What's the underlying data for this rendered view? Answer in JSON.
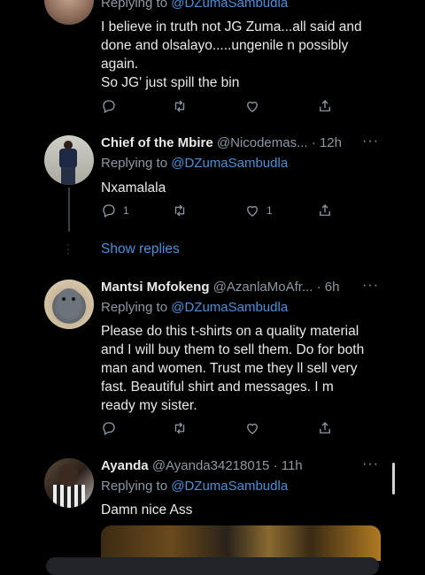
{
  "tweets": [
    {
      "reply_to_label": "Replying to ",
      "reply_to_handle": "@DZumaSambudla",
      "text_lines": [
        "I believe in truth not JG Zuma...all said and",
        "done and olsalayo.....ungenile n possibly",
        "again.",
        "So JG' just spill the bin"
      ]
    },
    {
      "name": "Chief of the Mbire",
      "handle": "@Nicodemas...",
      "time": "· 12h",
      "reply_to_label": "Replying to ",
      "reply_to_handle": "@DZumaSambudla",
      "text": "Nxamalala",
      "reply_count": "1",
      "like_count": "1"
    },
    {
      "name": "Mantsi Mofokeng",
      "handle": "@AzanlaMoAfr...",
      "time": "· 6h",
      "reply_to_label": "Replying to ",
      "reply_to_handle": "@DZumaSambudla",
      "text_lines": [
        "Please do this t-shirts on a quality material",
        "and I will buy them to sell them. Do for both",
        "man and women. Trust me they ll sell very",
        "fast. Beautiful shirt and messages. I m",
        "ready my sister."
      ]
    },
    {
      "name": "Ayanda",
      "handle": "@Ayanda34218015",
      "time": "· 11h",
      "reply_to_label": "Replying to ",
      "reply_to_handle": "@DZumaSambudla",
      "text": "Damn nice Ass"
    }
  ],
  "show_replies": "Show replies",
  "more_glyph": "···",
  "icons": [
    "reply-icon",
    "retweet-icon",
    "like-icon",
    "share-icon",
    "more-icon"
  ],
  "colors": {
    "background": "#000000",
    "link": "#4a90d9",
    "secondary": "#8b98a5",
    "text": "#e7e9ea"
  }
}
